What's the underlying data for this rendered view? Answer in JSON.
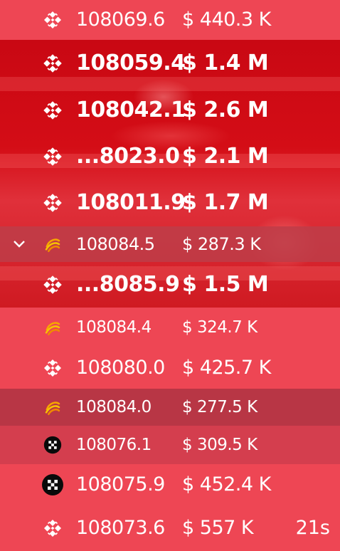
{
  "colors": {
    "row_red": "#ee4654",
    "row_dark": "#b83645",
    "row_mid": "#d43e4e",
    "photo_red": "#d40d16",
    "text": "#ffffff"
  },
  "trades": [
    {
      "icon": "binance-icon",
      "price": "108069.6",
      "amount": "$ 440.3 K",
      "age": "",
      "style": "normal"
    },
    {
      "icon": "binance-icon",
      "price": "108059.4",
      "amount": "$ 1.4 M",
      "age": "",
      "style": "big"
    },
    {
      "icon": "binance-icon",
      "price": "108042.1",
      "amount": "$ 2.6 M",
      "age": "",
      "style": "big"
    },
    {
      "icon": "binance-icon",
      "price": "...8023.0",
      "amount": "$ 2.1 M",
      "age": "",
      "style": "big"
    },
    {
      "icon": "binance-icon",
      "price": "108011.9",
      "amount": "$ 1.7 M",
      "age": "",
      "style": "big"
    },
    {
      "icon": "bybit-swirl-icon",
      "price": "108084.5",
      "amount": "$ 287.3 K",
      "age": "",
      "style": "group",
      "expanded": true
    },
    {
      "icon": "binance-icon",
      "price": "...8085.9",
      "amount": "$ 1.5 M",
      "age": "",
      "style": "big"
    },
    {
      "icon": "bybit-swirl-icon",
      "price": "108084.4",
      "amount": "$ 324.7 K",
      "age": "",
      "style": "small"
    },
    {
      "icon": "binance-icon",
      "price": "108080.0",
      "amount": "$ 425.7 K",
      "age": "",
      "style": "normal"
    },
    {
      "icon": "bybit-swirl-icon",
      "price": "108084.0",
      "amount": "$ 277.5 K",
      "age": "",
      "style": "small-dark"
    },
    {
      "icon": "okx-icon",
      "price": "108076.1",
      "amount": "$ 309.5 K",
      "age": "",
      "style": "small-mid"
    },
    {
      "icon": "okx-icon",
      "price": "108075.9",
      "amount": "$ 452.4 K",
      "age": "",
      "style": "normal"
    },
    {
      "icon": "binance-icon",
      "price": "108073.6",
      "amount": "$ 557 K",
      "age": "21s",
      "style": "normal"
    }
  ]
}
